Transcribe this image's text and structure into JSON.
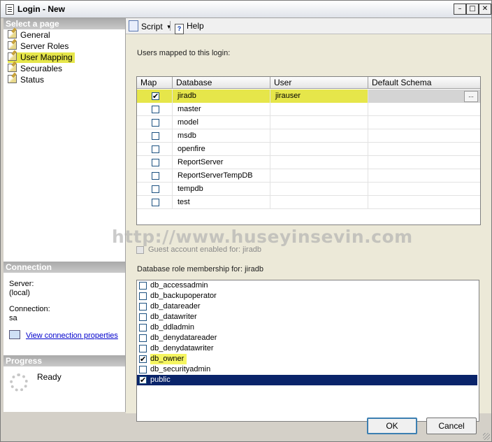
{
  "window": {
    "title": "Login - New"
  },
  "left_panel": {
    "select_page_header": "Select a page",
    "pages": [
      {
        "label": "General",
        "selected": false
      },
      {
        "label": "Server Roles",
        "selected": false
      },
      {
        "label": "User Mapping",
        "selected": true
      },
      {
        "label": "Securables",
        "selected": false
      },
      {
        "label": "Status",
        "selected": false
      }
    ],
    "connection": {
      "header": "Connection",
      "server_label": "Server:",
      "server_value": "(local)",
      "connection_label": "Connection:",
      "connection_value": "sa",
      "view_link": "View connection properties"
    },
    "progress": {
      "header": "Progress",
      "status": "Ready"
    }
  },
  "toolbar": {
    "script_label": "Script",
    "help_label": "Help"
  },
  "mapping": {
    "label": "Users mapped to this login:",
    "columns": [
      "Map",
      "Database",
      "User",
      "Default Schema"
    ],
    "rows": [
      {
        "map": true,
        "database": "jiradb",
        "user": "jirauser",
        "schema": "",
        "selected": true
      },
      {
        "map": false,
        "database": "master",
        "user": "",
        "schema": ""
      },
      {
        "map": false,
        "database": "model",
        "user": "",
        "schema": ""
      },
      {
        "map": false,
        "database": "msdb",
        "user": "",
        "schema": ""
      },
      {
        "map": false,
        "database": "openfire",
        "user": "",
        "schema": ""
      },
      {
        "map": false,
        "database": "ReportServer",
        "user": "",
        "schema": ""
      },
      {
        "map": false,
        "database": "ReportServerTempDB",
        "user": "",
        "schema": ""
      },
      {
        "map": false,
        "database": "tempdb",
        "user": "",
        "schema": ""
      },
      {
        "map": false,
        "database": "test",
        "user": "",
        "schema": ""
      }
    ],
    "ellipsis_label": "..."
  },
  "watermark": "http://www.huseyinsevin.com",
  "guest": {
    "label": "Guest account enabled for: jiradb",
    "checked": false
  },
  "roles": {
    "label": "Database role membership for: jiradb",
    "items": [
      {
        "name": "db_accessadmin",
        "checked": false
      },
      {
        "name": "db_backupoperator",
        "checked": false
      },
      {
        "name": "db_datareader",
        "checked": false
      },
      {
        "name": "db_datawriter",
        "checked": false
      },
      {
        "name": "db_ddladmin",
        "checked": false
      },
      {
        "name": "db_denydatareader",
        "checked": false
      },
      {
        "name": "db_denydatawriter",
        "checked": false
      },
      {
        "name": "db_owner",
        "checked": true,
        "highlight": true
      },
      {
        "name": "db_securityadmin",
        "checked": false
      },
      {
        "name": "public",
        "checked": true,
        "selected": true
      }
    ]
  },
  "buttons": {
    "ok": "OK",
    "cancel": "Cancel"
  }
}
